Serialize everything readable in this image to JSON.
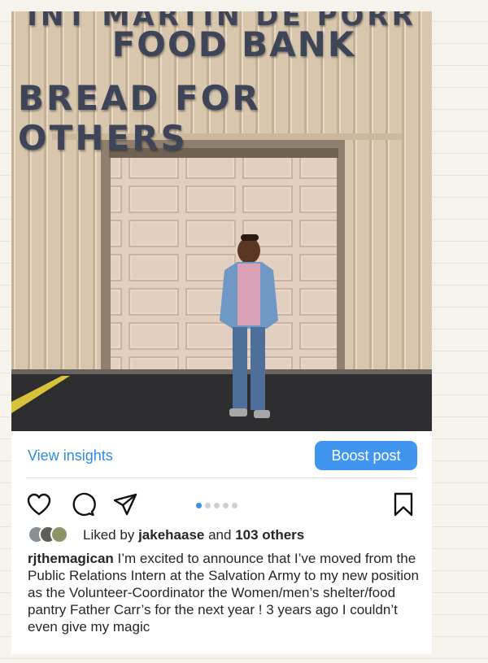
{
  "photo": {
    "sign_top": "INT MARTIN DE PORR",
    "sign_line1": "FOOD BANK",
    "sign_line2": "BREAD FOR OTHERS"
  },
  "insights": {
    "view_label": "View insights",
    "boost_label": "Boost post"
  },
  "actions": {
    "icons": [
      "heart-icon",
      "comment-icon",
      "share-icon",
      "bookmark-icon"
    ],
    "carousel_count": 5,
    "carousel_active": 1
  },
  "likes": {
    "prefix": "Liked by",
    "user": "jakehaase",
    "connector": "and",
    "others": "103 others"
  },
  "caption": {
    "username": "rjthemagican",
    "text": "I’m excited to announce that I’ve moved from the Public Relations Intern at the Salvation Army to my new position as the Volunteer-Coordinator the Women/men’s shelter/food pantry Father Carr’s for the next year ! 3 years ago I couldn’t even give my magic"
  },
  "colors": {
    "link_blue": "#2f8bd8",
    "button_blue": "#4096ee",
    "carousel_active": "#3a8fe6"
  }
}
